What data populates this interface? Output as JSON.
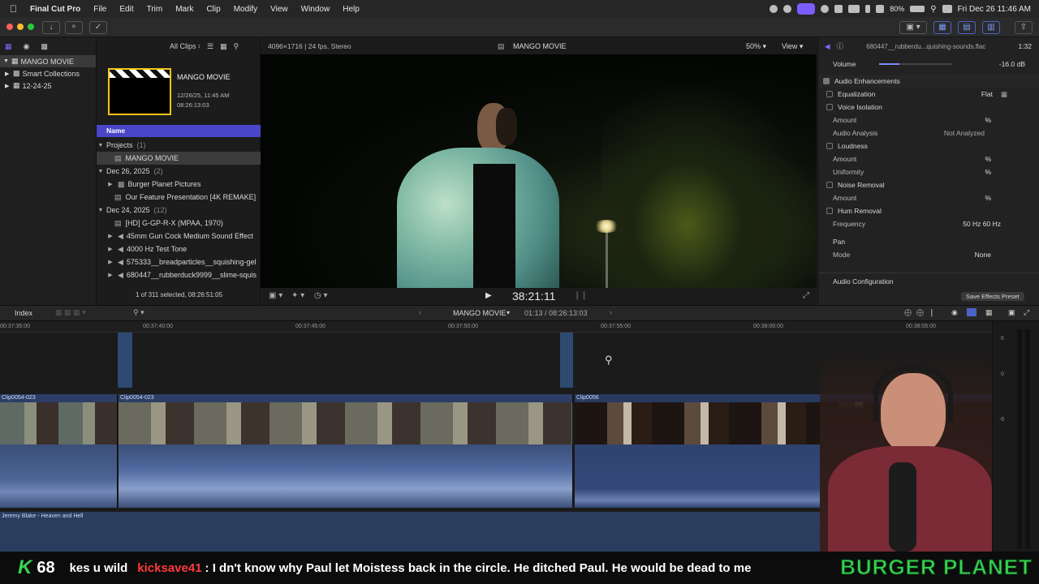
{
  "menubar": {
    "app": "Final Cut Pro",
    "items": [
      "File",
      "Edit",
      "Trim",
      "Mark",
      "Clip",
      "Modify",
      "View",
      "Window",
      "Help"
    ],
    "battery": "80%",
    "datetime": "Fri Dec 26  11:46 AM"
  },
  "library": {
    "items": [
      {
        "label": "MANGO MOVIE"
      },
      {
        "label": "Smart Collections"
      },
      {
        "label": "12-24-25"
      }
    ]
  },
  "browser": {
    "filter": "All Clips",
    "thumb": {
      "title": "MANGO MOVIE",
      "date": "12/26/25, 11:45 AM",
      "duration": "08:26:13:03"
    },
    "column": "Name",
    "rows": [
      {
        "label": "Projects",
        "count": "(1)",
        "kind": "group"
      },
      {
        "label": "MANGO MOVIE",
        "kind": "item",
        "selected": true
      },
      {
        "label": "Dec 26, 2025",
        "count": "(2)",
        "kind": "group"
      },
      {
        "label": "Burger Planet Pictures",
        "kind": "item"
      },
      {
        "label": "Our Feature Presentation [4K REMAKE]",
        "kind": "item"
      },
      {
        "label": "Dec 24, 2025",
        "count": "(12)",
        "kind": "group"
      },
      {
        "label": "[HD] G-GP-R-X (MPAA, 1970)",
        "kind": "item"
      },
      {
        "label": "45mm Gun Cock Medium Sound Effect",
        "kind": "item"
      },
      {
        "label": "4000 Hz Test Tone",
        "kind": "item"
      },
      {
        "label": "575333__breadparticles__squishing-gel",
        "kind": "item"
      },
      {
        "label": "680447__rubberduck9999__slime-squis",
        "kind": "item"
      }
    ],
    "status": "1 of 311 selected, 08:26:51:05"
  },
  "viewer": {
    "format": "4096×1716 | 24 fps, Stereo",
    "title": "MANGO MOVIE",
    "zoom": "50%",
    "view_label": "View",
    "timecode": "38:21:11"
  },
  "inspector": {
    "clip_name": "680447__rubberdu...quishing-sounds.flac",
    "duration": "1:32",
    "rows": [
      {
        "label": "Volume",
        "value": "-16.0  dB"
      },
      {
        "label": "Audio Enhancements",
        "value": ""
      },
      {
        "label": "Equalization",
        "value": "Flat"
      },
      {
        "label": "Voice Isolation",
        "value": ""
      },
      {
        "label": "Amount",
        "value": "%"
      },
      {
        "label": "Audio Analysis",
        "value": "Not Analyzed"
      },
      {
        "label": "Loudness",
        "value": ""
      },
      {
        "label": "Amount",
        "value": "%"
      },
      {
        "label": "Uniformity",
        "value": "%"
      },
      {
        "label": "Noise Removal",
        "value": ""
      },
      {
        "label": "Amount",
        "value": "%"
      },
      {
        "label": "Hum Removal",
        "value": ""
      },
      {
        "label": "Frequency",
        "value": "50 Hz     60 Hz"
      },
      {
        "label": "Pan",
        "value": ""
      },
      {
        "label": "Mode",
        "value": "None"
      }
    ],
    "audio_config": "Audio Configuration",
    "save_preset": "Save Effects Preset"
  },
  "timeline": {
    "index_label": "Index",
    "project": "MANGO MOVIE",
    "position": "01:13 / 08:26:13:03",
    "ruler": [
      "00:37:35:00",
      "00:37:40:00",
      "00:37:45:00",
      "00:37:50:00",
      "00:37:55:00",
      "00:38:00:00",
      "00:38:05:00"
    ],
    "clips": [
      "Clip0054-023",
      "Clip0054-023",
      "Clip0056"
    ],
    "music": "Jeremy Blake - Heaven and Hell"
  },
  "meters": {
    "scale": [
      "6",
      "0",
      "-6"
    ]
  },
  "ticker": {
    "icon": "K",
    "count": "68",
    "fragment": "kes u wild",
    "user": "kicksave41",
    "message": ": I dn't know why Paul let Moistess back in the circle. He ditched Paul. He would be dead to me",
    "brand": "BURGER PLANET"
  },
  "colors": {
    "accent": "#7b5cff",
    "selection": "#4b45c8",
    "clip": "#3a4f78",
    "ticker_green": "#39d353"
  },
  "icons": [
    "apple-icon",
    "search-icon",
    "gear-icon",
    "play-icon",
    "zoom-icon",
    "speaker-icon"
  ]
}
